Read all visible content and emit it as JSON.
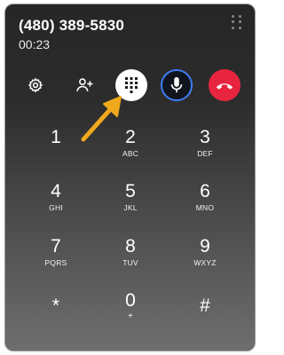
{
  "call": {
    "phone_number": "(480) 389-5830",
    "duration": "00:23"
  },
  "controls": {
    "settings_icon": "gear-icon",
    "add_person_icon": "person-add-icon",
    "dialpad_icon": "dialpad-icon",
    "mic_icon": "microphone-icon",
    "hangup_icon": "phone-hangup-icon"
  },
  "colors": {
    "hangup": "#e8253f",
    "mic_ring": "#3e7df6",
    "annotation_arrow": "#f0a81d"
  },
  "keypad": [
    {
      "digit": "1",
      "letters": ""
    },
    {
      "digit": "2",
      "letters": "ABC"
    },
    {
      "digit": "3",
      "letters": "DEF"
    },
    {
      "digit": "4",
      "letters": "GHI"
    },
    {
      "digit": "5",
      "letters": "JKL"
    },
    {
      "digit": "6",
      "letters": "MNO"
    },
    {
      "digit": "7",
      "letters": "PQRS"
    },
    {
      "digit": "8",
      "letters": "TUV"
    },
    {
      "digit": "9",
      "letters": "WXYZ"
    },
    {
      "digit": "*",
      "letters": ""
    },
    {
      "digit": "0",
      "letters": "+"
    },
    {
      "digit": "#",
      "letters": ""
    }
  ]
}
